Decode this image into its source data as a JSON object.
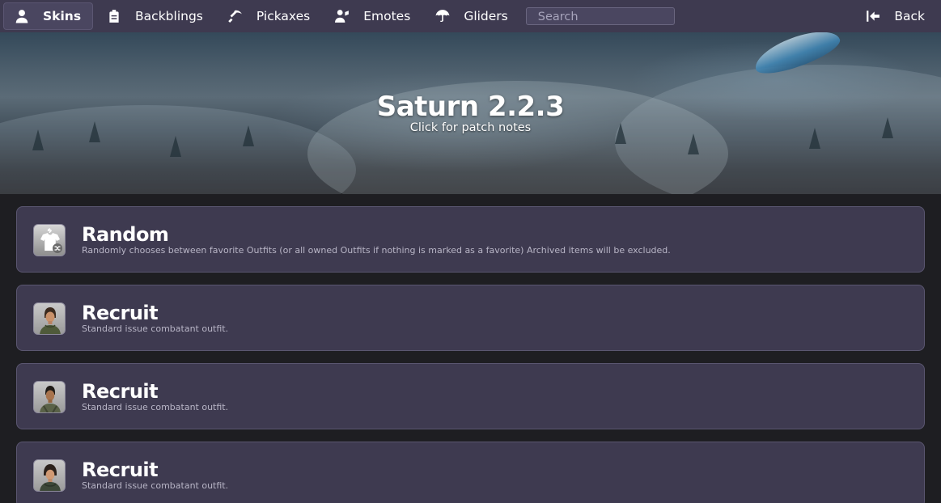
{
  "nav": {
    "items": [
      {
        "label": "Skins",
        "icon": "user-icon",
        "active": true
      },
      {
        "label": "Backblings",
        "icon": "backpack-icon",
        "active": false
      },
      {
        "label": "Pickaxes",
        "icon": "pickaxe-icon",
        "active": false
      },
      {
        "label": "Emotes",
        "icon": "emote-icon",
        "active": false
      },
      {
        "label": "Gliders",
        "icon": "umbrella-icon",
        "active": false
      }
    ],
    "search_placeholder": "Search",
    "back_label": "Back",
    "back_icon": "back-arrow-icon"
  },
  "hero": {
    "title": "Saturn 2.2.3",
    "subtitle": "Click for patch notes"
  },
  "items": [
    {
      "name": "Random",
      "description": "Randomly chooses between favorite Outfits (or all owned Outfits if nothing is marked as a favorite) Archived items will be excluded.",
      "icon": "random-shirt-icon"
    },
    {
      "name": "Recruit",
      "description": "Standard issue combatant outfit.",
      "icon": "recruit-portrait-icon"
    },
    {
      "name": "Recruit",
      "description": "Standard issue combatant outfit.",
      "icon": "recruit-portrait-icon"
    },
    {
      "name": "Recruit",
      "description": "Standard issue combatant outfit.",
      "icon": "recruit-portrait-icon"
    }
  ],
  "colors": {
    "nav_bg": "#3e3a50",
    "card_bg": "#3e3a50",
    "page_bg": "#1e1e22"
  }
}
